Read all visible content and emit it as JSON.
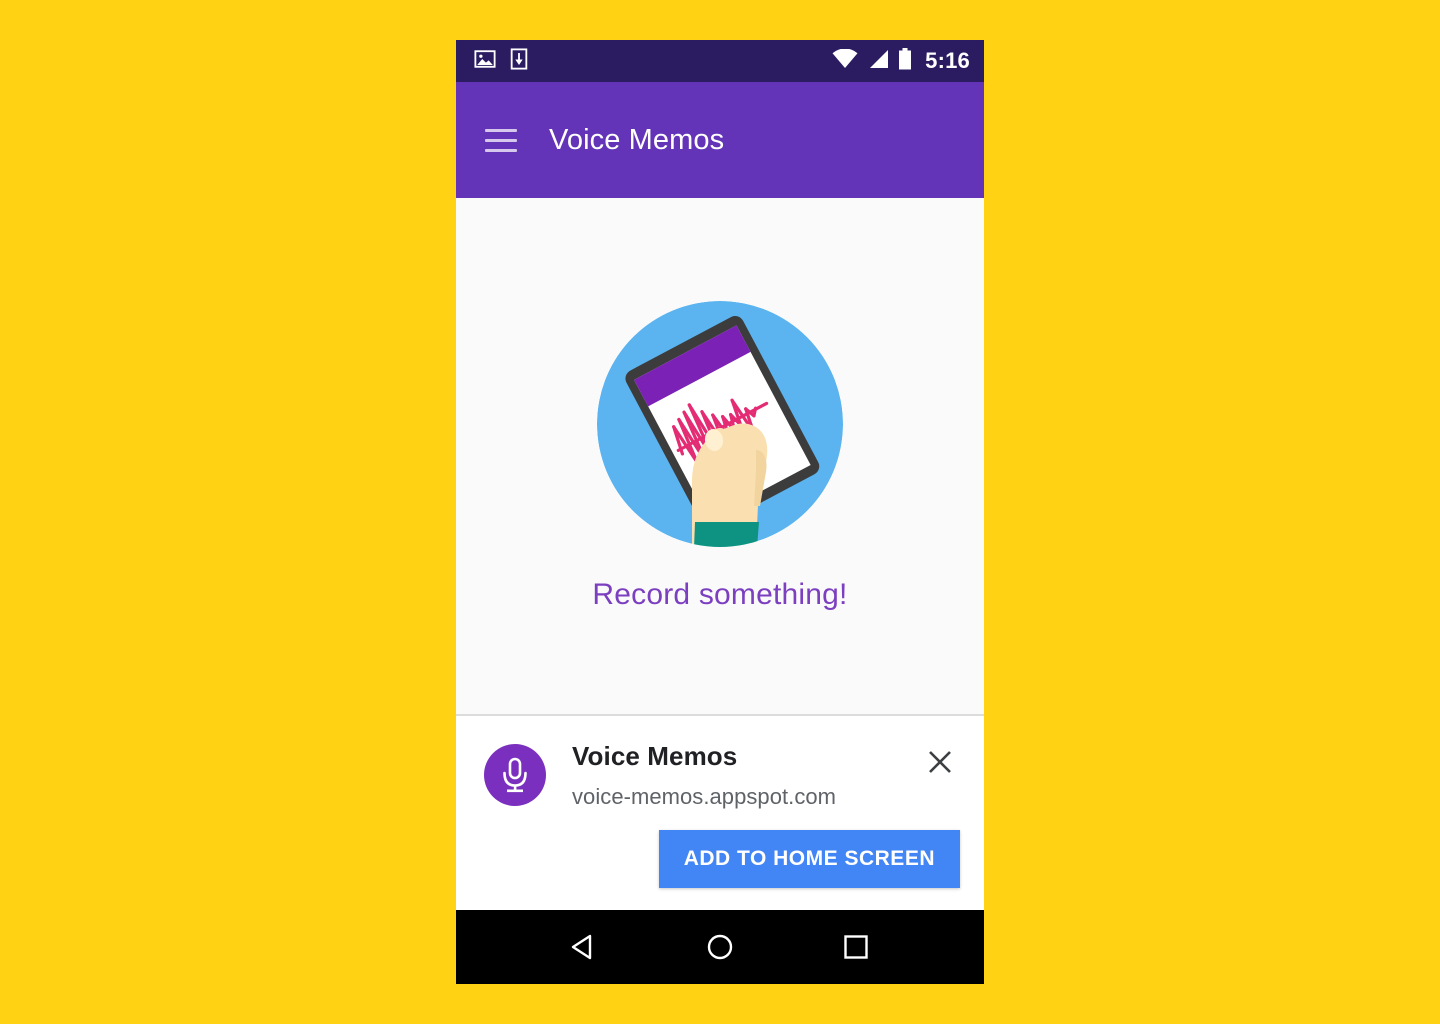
{
  "canvas": {
    "background_color": "#FFD213"
  },
  "status_bar": {
    "background_color": "#2B1B61",
    "time": "5:16",
    "left_icons": [
      {
        "name": "screenshot-image-icon"
      },
      {
        "name": "download-icon"
      }
    ],
    "right_icons": [
      {
        "name": "wifi-icon"
      },
      {
        "name": "cellular-signal-icon"
      },
      {
        "name": "battery-icon"
      }
    ]
  },
  "app_bar": {
    "background_color": "#6434B8",
    "menu_icon": "hamburger-menu-icon",
    "title": "Voice Memos"
  },
  "content": {
    "background_color": "#FAFAFA",
    "illustration": {
      "name": "hand-holding-phone-recording-illustration",
      "circle_color": "#5BB4F0",
      "phone_frame_color": "#3C3C3C",
      "phone_screen_color": "#FFFFFF",
      "phone_header_color": "#7B21B5",
      "waveform_color": "#E32C74",
      "skin_color": "#FAE0B0",
      "sleeve_color": "#0E9383"
    },
    "empty_message": "Record something!",
    "empty_message_color": "#7B3FBF"
  },
  "install_banner": {
    "background_color": "#FFFFFF",
    "app_icon": {
      "name": "microphone-icon",
      "circle_color": "#7B2FBE",
      "glyph_color": "#FFFFFF"
    },
    "app_name": "Voice Memos",
    "app_url": "voice-memos.appspot.com",
    "close_icon": "close-icon",
    "install_button": {
      "label": "ADD TO HOME SCREEN",
      "background_color": "#4285F4",
      "text_color": "#FFFFFF"
    }
  },
  "nav_bar": {
    "background_color": "#000000",
    "buttons": [
      {
        "name": "back-button",
        "icon": "back-triangle-icon"
      },
      {
        "name": "home-button",
        "icon": "home-circle-icon"
      },
      {
        "name": "recents-button",
        "icon": "recents-square-icon"
      }
    ]
  }
}
